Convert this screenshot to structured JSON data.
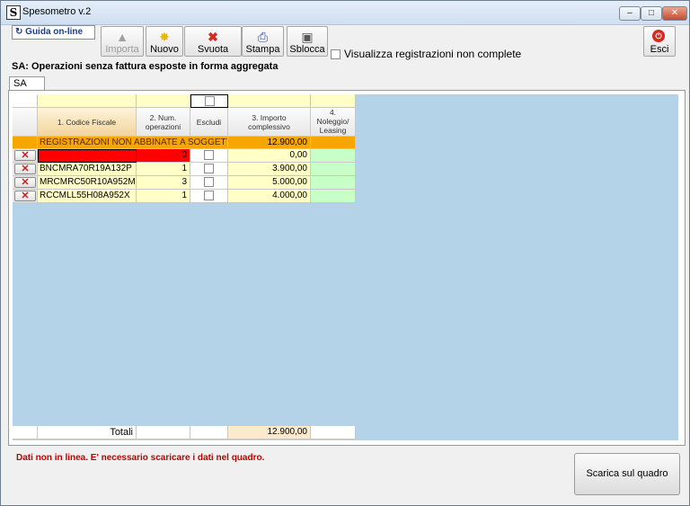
{
  "window": {
    "title": "Spesometro v.2",
    "icon_letter": "S"
  },
  "toolbar": {
    "guida_label": "Guida on-line",
    "buttons": [
      {
        "label": "Importa",
        "icon": "import-icon",
        "enabled": false
      },
      {
        "label": "Nuovo",
        "icon": "new-star-icon",
        "enabled": true
      },
      {
        "label": "Svuota",
        "icon": "clear-x-icon",
        "enabled": true
      },
      {
        "label": "Stampa",
        "icon": "printer-icon",
        "enabled": true
      },
      {
        "label": "Sblocca",
        "icon": "padlock-icon",
        "enabled": true
      }
    ],
    "visualizza_label": "Visualizza registrazioni non complete",
    "esci_label": "Esci"
  },
  "heading": "SA: Operazioni senza fattura esposte in forma aggregata",
  "tab": {
    "label": "SA"
  },
  "grid": {
    "columns": [
      "1. Codice Fiscale",
      "2. Num. operazioni",
      "Escludi",
      "3. Importo complessivo",
      "4. Noleggio/ Leasing"
    ],
    "summary_row": {
      "label": "REGISTRAZIONI NON ABBINATE A SOGGETTI",
      "importo": "12.900,00"
    },
    "rows": [
      {
        "codice": "",
        "num": "0",
        "importo": "0,00"
      },
      {
        "codice": "BNCMRA70R19A132P",
        "num": "1",
        "importo": "3.900,00"
      },
      {
        "codice": "MRCMRC50R10A952M",
        "num": "3",
        "importo": "5.000,00"
      },
      {
        "codice": "RCCMLL55H08A952X",
        "num": "1",
        "importo": "4.000,00"
      }
    ],
    "totals": {
      "label": "Totali",
      "importo": "12.900,00"
    }
  },
  "status_message": "Dati non in linea. E' necessario scaricare i dati nel quadro.",
  "scarica_label": "Scarica sul quadro",
  "colors": {
    "summary_orange": "#f7a600",
    "error_red": "#ff0000",
    "grid_bg": "#b5d3e8",
    "input_yellow": "#ffffc8",
    "leasing_green": "#c8ffc8"
  }
}
